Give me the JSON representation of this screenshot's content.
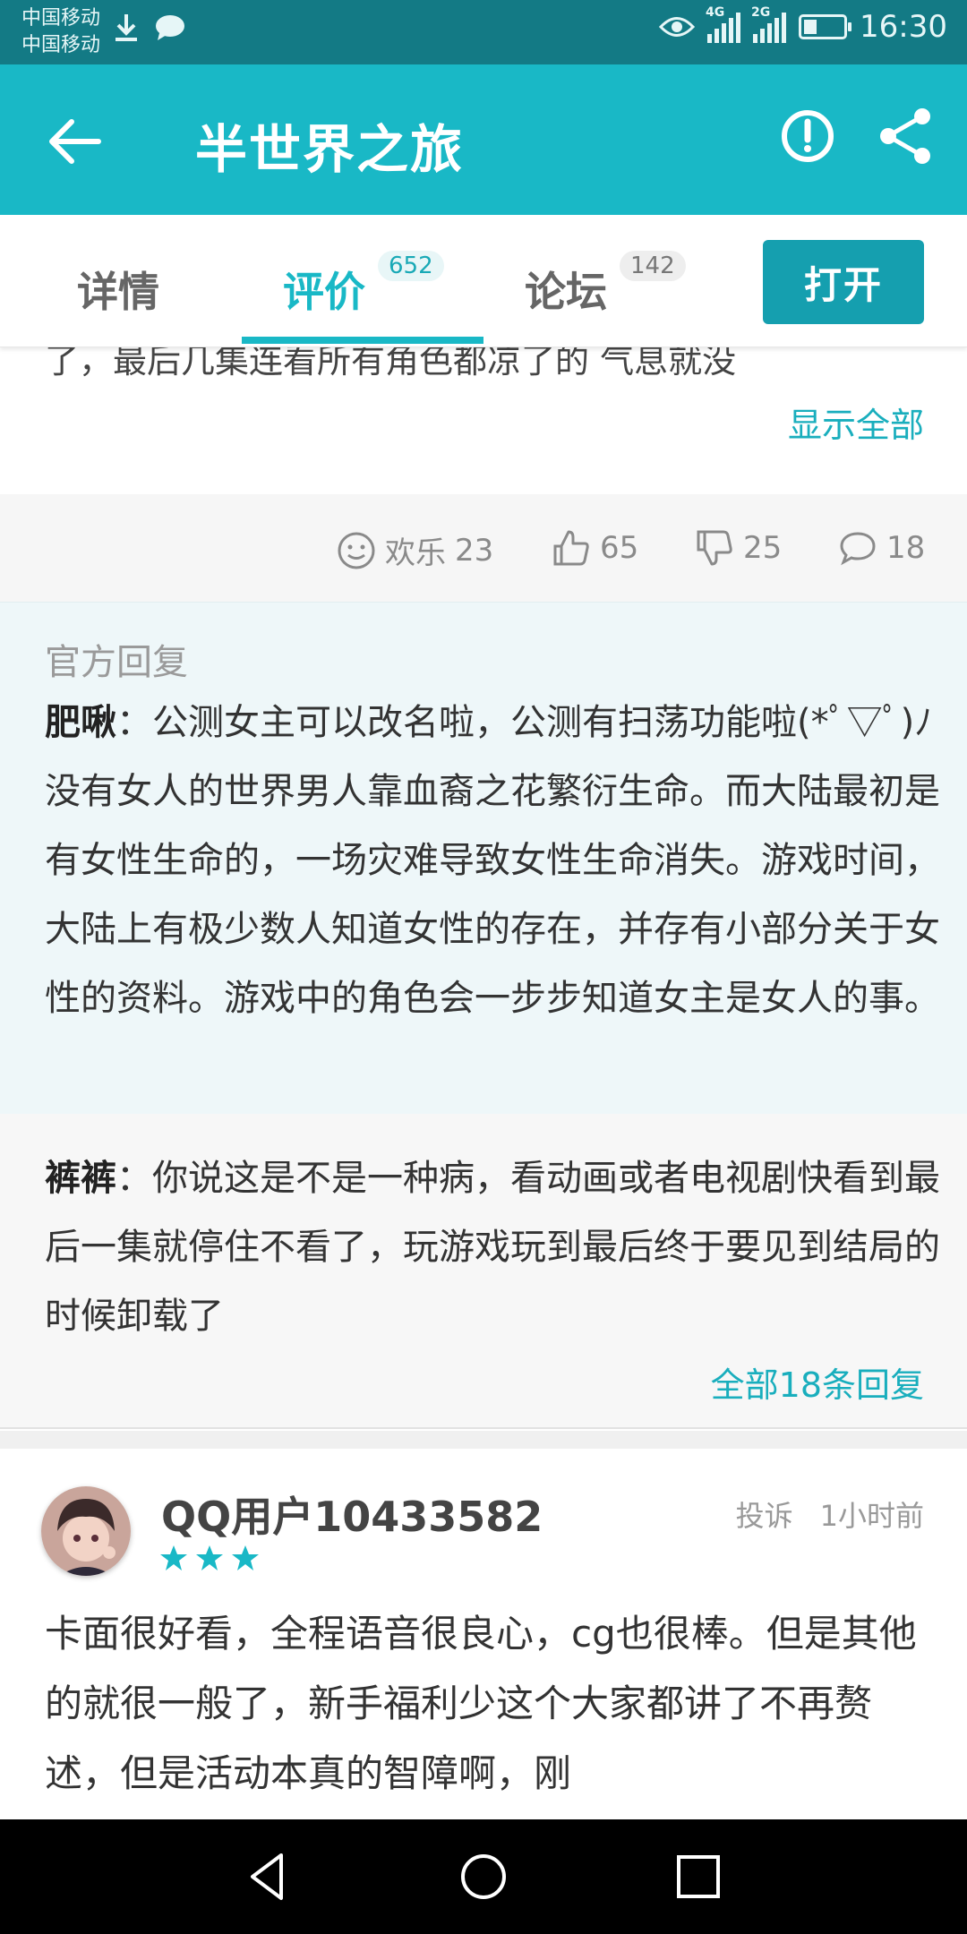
{
  "status_bar": {
    "carrier_1": "中国移动",
    "carrier_2": "中国移动",
    "net_1": "4G",
    "net_2": "2G",
    "time": "16:30"
  },
  "app_bar": {
    "title": "半世界之旅"
  },
  "tabs": [
    {
      "label": "详情",
      "count": ""
    },
    {
      "label": "评价",
      "count": "652"
    },
    {
      "label": "论坛",
      "count": "142"
    }
  ],
  "open_button": "打开",
  "previous_review": {
    "partial_text": "了，最后几集连看所有角色都凉了的 气息就没",
    "show_all": "显示全部"
  },
  "reactions": {
    "funny_label": "欢乐",
    "funny_count": "23",
    "like_count": "65",
    "dislike_count": "25",
    "comment_count": "18"
  },
  "official_reply": {
    "title": "官方回复",
    "user": "肥啾",
    "text": "：公测女主可以改名啦，公测有扫荡功能啦(*ﾟ▽ﾟ)ﾉ 没有女人的世界男人靠血裔之花繁衍生命。而大陆最初是有女性生命的，一场灾难导致女性生命消失。游戏时间，大陆上有极少数人知道女性的存在，并存有小部分关于女性的资料。游戏中的角色会一步步知道女主是女人的事。"
  },
  "reply": {
    "user": "裤裤",
    "text": "：你说这是不是一种病，看动画或者电视剧快看到最后一集就停住不看了，玩游戏玩到最后终于要见到结局的时候卸载了",
    "all_replies": "全部18条回复"
  },
  "review": {
    "user": "QQ用户10433582",
    "rating": 3,
    "report": "投诉",
    "time": "1小时前",
    "text": "卡面很好看，全程语音很良心，cg也很棒。但是其他的就很一般了，新手福利少这个大家都讲了不再赘述，但是活动本真的智障啊，刚"
  },
  "colors": {
    "accent": "#19b8c6",
    "status_bar": "#137a85",
    "open_button": "#159faf",
    "link": "#19aebd",
    "star": "#19b8c6"
  }
}
